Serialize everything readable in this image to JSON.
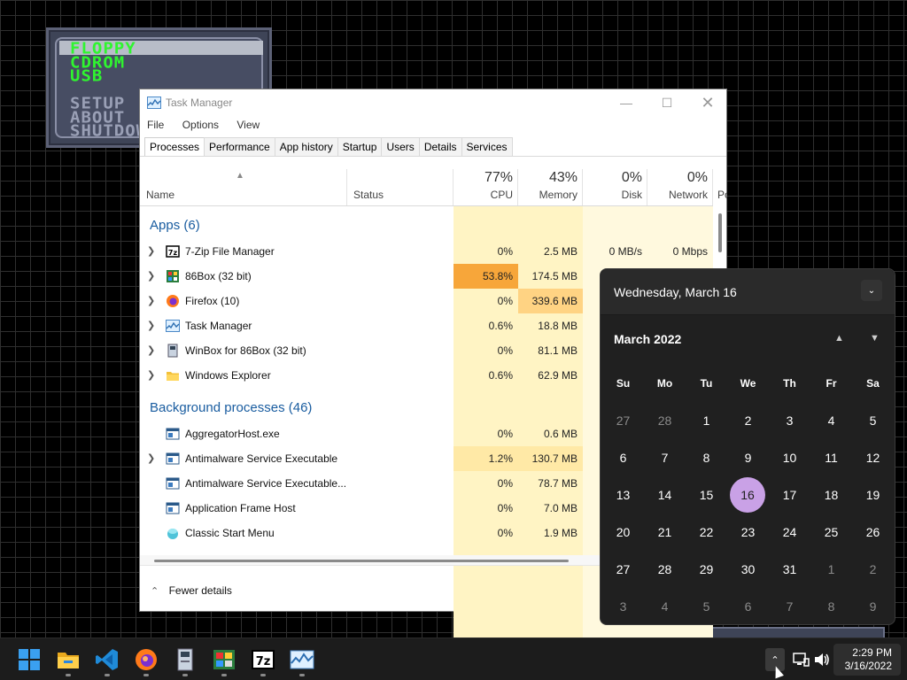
{
  "boot_menu": {
    "items": [
      "FLOPPY",
      "CDROM",
      "USB",
      "SETUP",
      "ABOUT",
      "SHUTDOWN"
    ]
  },
  "task_manager": {
    "title": "Task Manager",
    "menu": [
      "File",
      "Options",
      "View"
    ],
    "tabs": [
      "Processes",
      "Performance",
      "App history",
      "Startup",
      "Users",
      "Details",
      "Services"
    ],
    "active_tab": "Processes",
    "columns": {
      "name": "Name",
      "status": "Status",
      "cpu": {
        "pct": "77%",
        "label": "CPU"
      },
      "memory": {
        "pct": "43%",
        "label": "Memory"
      },
      "disk": {
        "pct": "0%",
        "label": "Disk"
      },
      "network": {
        "pct": "0%",
        "label": "Network"
      },
      "power_partial": "Po"
    },
    "apps_group": "Apps (6)",
    "apps": [
      {
        "name": "7-Zip File Manager",
        "cpu": "0%",
        "memory": "2.5 MB",
        "disk": "0 MB/s",
        "network": "0 Mbps",
        "expand": true
      },
      {
        "name": "86Box (32 bit)",
        "cpu": "53.8%",
        "memory": "174.5 MB",
        "expand": true
      },
      {
        "name": "Firefox (10)",
        "cpu": "0%",
        "memory": "339.6 MB",
        "expand": true
      },
      {
        "name": "Task Manager",
        "cpu": "0.6%",
        "memory": "18.8 MB",
        "expand": true
      },
      {
        "name": "WinBox for 86Box (32 bit)",
        "cpu": "0%",
        "memory": "81.1 MB",
        "expand": true
      },
      {
        "name": "Windows Explorer",
        "cpu": "0.6%",
        "memory": "62.9 MB",
        "expand": true
      }
    ],
    "bg_group": "Background processes (46)",
    "background": [
      {
        "name": "AggregatorHost.exe",
        "cpu": "0%",
        "memory": "0.6 MB",
        "expand": false
      },
      {
        "name": "Antimalware Service Executable",
        "cpu": "1.2%",
        "memory": "130.7 MB",
        "expand": true
      },
      {
        "name": "Antimalware Service Executable...",
        "cpu": "0%",
        "memory": "78.7 MB",
        "expand": false
      },
      {
        "name": "Application Frame Host",
        "cpu": "0%",
        "memory": "7.0 MB",
        "expand": false
      },
      {
        "name": "Classic Start Menu",
        "cpu": "0%",
        "memory": "1.9 MB",
        "expand": false
      }
    ],
    "fewer_details": "Fewer details"
  },
  "calendar": {
    "header_date": "Wednesday, March 16",
    "month_label": "March 2022",
    "weekdays": [
      "Su",
      "Mo",
      "Tu",
      "We",
      "Th",
      "Fr",
      "Sa"
    ],
    "weeks": [
      [
        "27",
        "28",
        "1",
        "2",
        "3",
        "4",
        "5"
      ],
      [
        "6",
        "7",
        "8",
        "9",
        "10",
        "11",
        "12"
      ],
      [
        "13",
        "14",
        "15",
        "16",
        "17",
        "18",
        "19"
      ],
      [
        "20",
        "21",
        "22",
        "23",
        "24",
        "25",
        "26"
      ],
      [
        "27",
        "28",
        "29",
        "30",
        "31",
        "1",
        "2"
      ],
      [
        "3",
        "4",
        "5",
        "6",
        "7",
        "8",
        "9"
      ]
    ],
    "today": "16"
  },
  "taskbar": {
    "apps": [
      "windows-start",
      "file-explorer",
      "visual-studio-code",
      "firefox",
      "winbox",
      "86box",
      "7-zip",
      "task-manager"
    ],
    "time": "2:29 PM",
    "date": "3/16/2022"
  }
}
